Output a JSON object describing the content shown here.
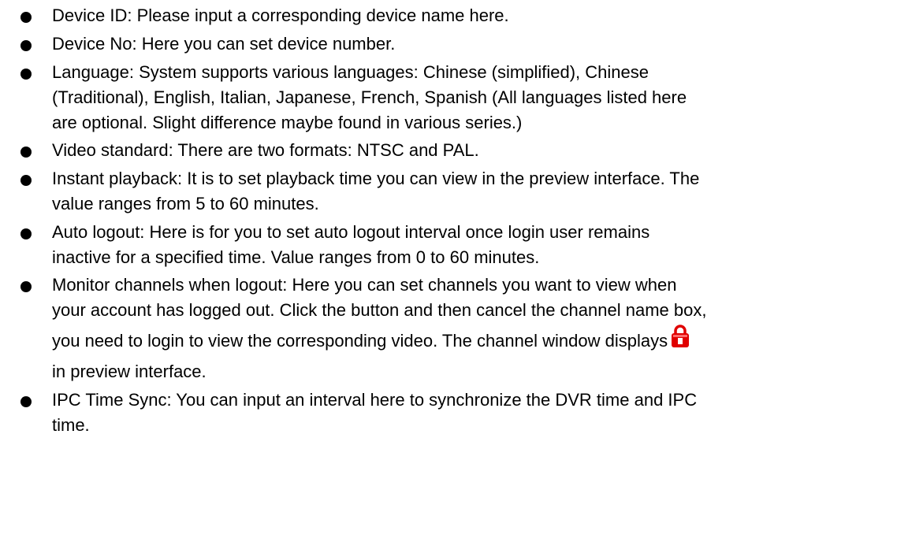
{
  "bullets": [
    {
      "lines": [
        "Device ID: Please input a corresponding device name here."
      ]
    },
    {
      "lines": [
        "Device No: Here you can set device number."
      ]
    },
    {
      "lines": [
        "Language: System supports various languages: Chinese (simplified), Chinese",
        "(Traditional), English, Italian, Japanese, French, Spanish (All languages listed here",
        "are optional. Slight difference maybe found in various series.)"
      ]
    },
    {
      "lines": [
        "Video standard: There are two formats: NTSC and PAL."
      ]
    },
    {
      "lines": [
        "Instant playback: It is to set playback time you can view in the preview interface. The",
        "value ranges from 5 to 60 minutes."
      ]
    },
    {
      "lines": [
        "Auto logout: Here is for you to set auto logout interval once login user remains",
        "inactive for a specified time. Value ranges from 0 to 60 minutes."
      ]
    },
    {
      "lines": [
        "Monitor channels when logout: Here you can set channels you want to view when",
        "your account has logged out. Click the button and then cancel the channel name box,",
        "you need to login to view the corresponding video. The channel window displays",
        "in preview interface."
      ],
      "inline_icon": "lock-icon",
      "lock_color": "#e00000"
    },
    {
      "lines": [
        "IPC Time Sync: You can input an interval here to synchronize the DVR time and IPC",
        "time."
      ]
    }
  ]
}
